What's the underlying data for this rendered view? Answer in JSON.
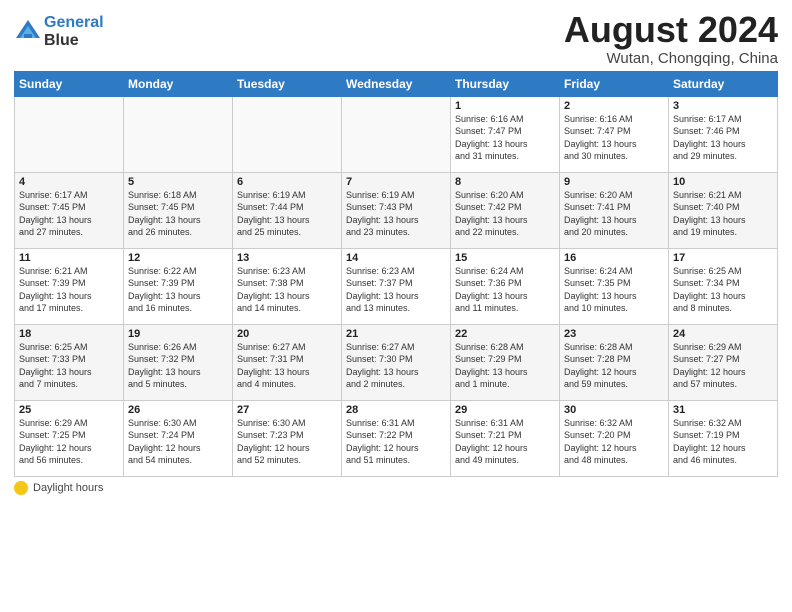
{
  "header": {
    "logo_line1": "General",
    "logo_line2": "Blue",
    "month": "August 2024",
    "location": "Wutan, Chongqing, China"
  },
  "days_of_week": [
    "Sunday",
    "Monday",
    "Tuesday",
    "Wednesday",
    "Thursday",
    "Friday",
    "Saturday"
  ],
  "legend": {
    "label": "Daylight hours"
  },
  "weeks": [
    [
      {
        "day": "",
        "info": ""
      },
      {
        "day": "",
        "info": ""
      },
      {
        "day": "",
        "info": ""
      },
      {
        "day": "",
        "info": ""
      },
      {
        "day": "1",
        "info": "Sunrise: 6:16 AM\nSunset: 7:47 PM\nDaylight: 13 hours\nand 31 minutes."
      },
      {
        "day": "2",
        "info": "Sunrise: 6:16 AM\nSunset: 7:47 PM\nDaylight: 13 hours\nand 30 minutes."
      },
      {
        "day": "3",
        "info": "Sunrise: 6:17 AM\nSunset: 7:46 PM\nDaylight: 13 hours\nand 29 minutes."
      }
    ],
    [
      {
        "day": "4",
        "info": "Sunrise: 6:17 AM\nSunset: 7:45 PM\nDaylight: 13 hours\nand 27 minutes."
      },
      {
        "day": "5",
        "info": "Sunrise: 6:18 AM\nSunset: 7:45 PM\nDaylight: 13 hours\nand 26 minutes."
      },
      {
        "day": "6",
        "info": "Sunrise: 6:19 AM\nSunset: 7:44 PM\nDaylight: 13 hours\nand 25 minutes."
      },
      {
        "day": "7",
        "info": "Sunrise: 6:19 AM\nSunset: 7:43 PM\nDaylight: 13 hours\nand 23 minutes."
      },
      {
        "day": "8",
        "info": "Sunrise: 6:20 AM\nSunset: 7:42 PM\nDaylight: 13 hours\nand 22 minutes."
      },
      {
        "day": "9",
        "info": "Sunrise: 6:20 AM\nSunset: 7:41 PM\nDaylight: 13 hours\nand 20 minutes."
      },
      {
        "day": "10",
        "info": "Sunrise: 6:21 AM\nSunset: 7:40 PM\nDaylight: 13 hours\nand 19 minutes."
      }
    ],
    [
      {
        "day": "11",
        "info": "Sunrise: 6:21 AM\nSunset: 7:39 PM\nDaylight: 13 hours\nand 17 minutes."
      },
      {
        "day": "12",
        "info": "Sunrise: 6:22 AM\nSunset: 7:39 PM\nDaylight: 13 hours\nand 16 minutes."
      },
      {
        "day": "13",
        "info": "Sunrise: 6:23 AM\nSunset: 7:38 PM\nDaylight: 13 hours\nand 14 minutes."
      },
      {
        "day": "14",
        "info": "Sunrise: 6:23 AM\nSunset: 7:37 PM\nDaylight: 13 hours\nand 13 minutes."
      },
      {
        "day": "15",
        "info": "Sunrise: 6:24 AM\nSunset: 7:36 PM\nDaylight: 13 hours\nand 11 minutes."
      },
      {
        "day": "16",
        "info": "Sunrise: 6:24 AM\nSunset: 7:35 PM\nDaylight: 13 hours\nand 10 minutes."
      },
      {
        "day": "17",
        "info": "Sunrise: 6:25 AM\nSunset: 7:34 PM\nDaylight: 13 hours\nand 8 minutes."
      }
    ],
    [
      {
        "day": "18",
        "info": "Sunrise: 6:25 AM\nSunset: 7:33 PM\nDaylight: 13 hours\nand 7 minutes."
      },
      {
        "day": "19",
        "info": "Sunrise: 6:26 AM\nSunset: 7:32 PM\nDaylight: 13 hours\nand 5 minutes."
      },
      {
        "day": "20",
        "info": "Sunrise: 6:27 AM\nSunset: 7:31 PM\nDaylight: 13 hours\nand 4 minutes."
      },
      {
        "day": "21",
        "info": "Sunrise: 6:27 AM\nSunset: 7:30 PM\nDaylight: 13 hours\nand 2 minutes."
      },
      {
        "day": "22",
        "info": "Sunrise: 6:28 AM\nSunset: 7:29 PM\nDaylight: 13 hours\nand 1 minute."
      },
      {
        "day": "23",
        "info": "Sunrise: 6:28 AM\nSunset: 7:28 PM\nDaylight: 12 hours\nand 59 minutes."
      },
      {
        "day": "24",
        "info": "Sunrise: 6:29 AM\nSunset: 7:27 PM\nDaylight: 12 hours\nand 57 minutes."
      }
    ],
    [
      {
        "day": "25",
        "info": "Sunrise: 6:29 AM\nSunset: 7:25 PM\nDaylight: 12 hours\nand 56 minutes."
      },
      {
        "day": "26",
        "info": "Sunrise: 6:30 AM\nSunset: 7:24 PM\nDaylight: 12 hours\nand 54 minutes."
      },
      {
        "day": "27",
        "info": "Sunrise: 6:30 AM\nSunset: 7:23 PM\nDaylight: 12 hours\nand 52 minutes."
      },
      {
        "day": "28",
        "info": "Sunrise: 6:31 AM\nSunset: 7:22 PM\nDaylight: 12 hours\nand 51 minutes."
      },
      {
        "day": "29",
        "info": "Sunrise: 6:31 AM\nSunset: 7:21 PM\nDaylight: 12 hours\nand 49 minutes."
      },
      {
        "day": "30",
        "info": "Sunrise: 6:32 AM\nSunset: 7:20 PM\nDaylight: 12 hours\nand 48 minutes."
      },
      {
        "day": "31",
        "info": "Sunrise: 6:32 AM\nSunset: 7:19 PM\nDaylight: 12 hours\nand 46 minutes."
      }
    ]
  ]
}
